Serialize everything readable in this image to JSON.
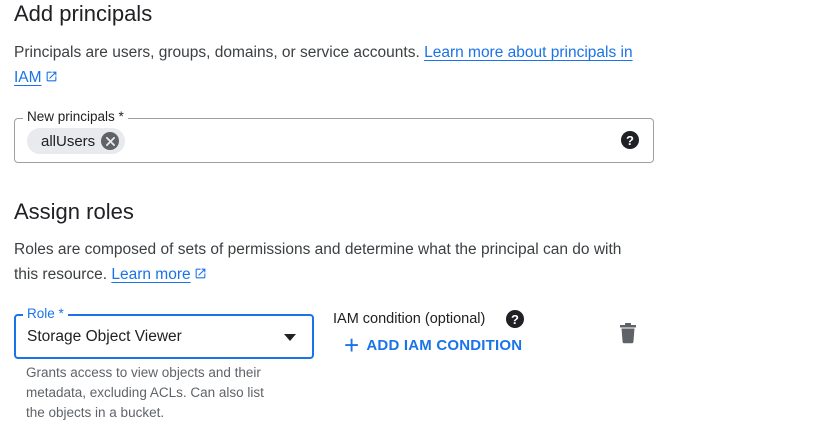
{
  "principals": {
    "heading": "Add principals",
    "description": "Principals are users, groups, domains, or service accounts.",
    "learn_more_link": "Learn more about principals in IAM",
    "field_label": "New principals *",
    "chips": [
      "allUsers"
    ],
    "help_glyph": "?"
  },
  "roles": {
    "heading": "Assign roles",
    "description": "Roles are composed of sets of permissions and determine what the principal can do with this resource.",
    "learn_more_link": "Learn more",
    "role_label": "Role *",
    "role_value": "Storage Object Viewer",
    "role_hint": "Grants access to view objects and their metadata, excluding ACLs. Can also list the objects in a bucket.",
    "iam_condition_label": "IAM condition (optional)",
    "help_glyph": "?",
    "add_condition_icon": "+",
    "add_condition_button": "ADD IAM CONDITION",
    "delete_icon": "trash-icon"
  },
  "colors": {
    "accent": "#1a73e8",
    "chip_bg": "#e8eaed",
    "outline": "#9aa0a6"
  }
}
